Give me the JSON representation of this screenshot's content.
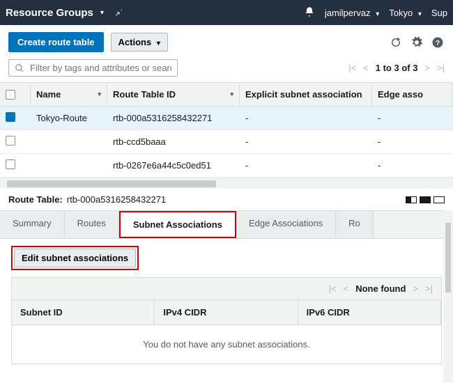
{
  "topbar": {
    "title": "Resource Groups",
    "user": "jamilpervaz",
    "region": "Tokyo",
    "support": "Sup"
  },
  "actionbar": {
    "create": "Create route table",
    "actions": "Actions"
  },
  "search": {
    "placeholder": "Filter by tags and attributes or search by keyword"
  },
  "pager": {
    "range": "1 to 3 of 3"
  },
  "columns": {
    "name": "Name",
    "rtid": "Route Table ID",
    "explicit": "Explicit subnet association",
    "edge": "Edge asso"
  },
  "rows": [
    {
      "name": "Tokyo-Route",
      "rtid": "rtb-000a5316258432271",
      "explicit": "-",
      "edge": "-",
      "selected": true
    },
    {
      "name": "",
      "rtid": "rtb-ccd5baaa",
      "explicit": "-",
      "edge": "-",
      "selected": false
    },
    {
      "name": "",
      "rtid": "rtb-0267e6a44c5c0ed51",
      "explicit": "-",
      "edge": "-",
      "selected": false
    }
  ],
  "detail": {
    "label": "Route Table:",
    "value": "rtb-000a5316258432271"
  },
  "tabs": {
    "summary": "Summary",
    "routes": "Routes",
    "subnet": "Subnet Associations",
    "edge": "Edge Associations",
    "rtprop": "Ro"
  },
  "pane": {
    "edit": "Edit subnet associations",
    "none": "None found",
    "col1": "Subnet ID",
    "col2": "IPv4 CIDR",
    "col3": "IPv6 CIDR",
    "empty": "You do not have any subnet associations."
  }
}
